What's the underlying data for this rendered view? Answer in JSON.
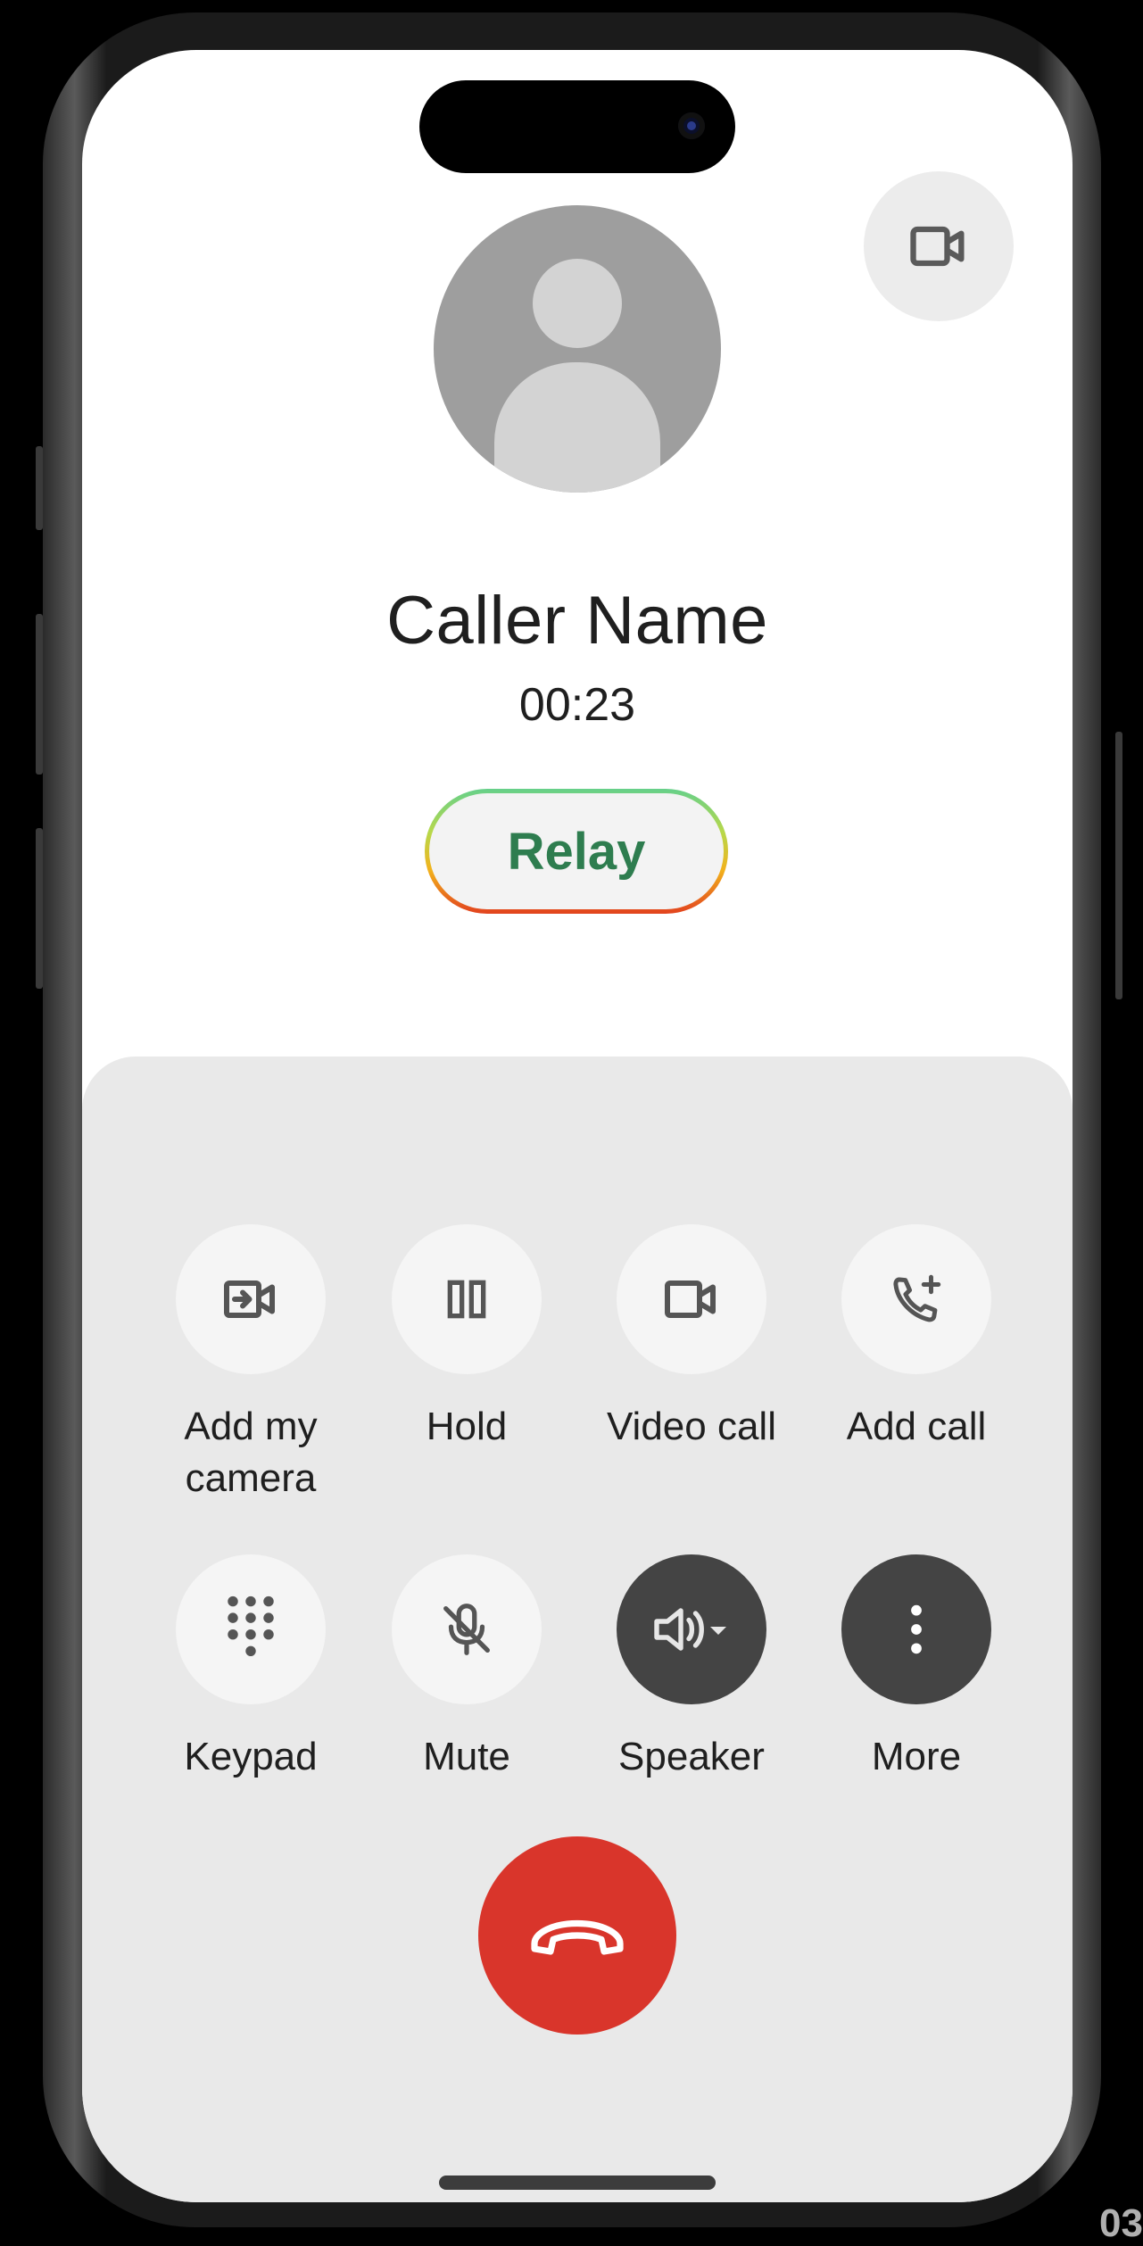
{
  "call": {
    "caller_name": "Caller Name",
    "duration": "00:23",
    "relay_label": "Relay"
  },
  "top_actions": {
    "video_icon": "video-camera-icon"
  },
  "controls": {
    "row1": [
      {
        "label": "Add my\ncamera",
        "icon": "add-camera-icon"
      },
      {
        "label": "Hold",
        "icon": "pause-icon"
      },
      {
        "label": "Video call",
        "icon": "video-camera-icon"
      },
      {
        "label": "Add call",
        "icon": "add-call-icon"
      }
    ],
    "row2": [
      {
        "label": "Keypad",
        "icon": "dialpad-icon"
      },
      {
        "label": "Mute",
        "icon": "mic-off-icon"
      },
      {
        "label": "Speaker",
        "icon": "speaker-icon",
        "active": true
      },
      {
        "label": "More",
        "icon": "more-vert-icon",
        "active": true
      }
    ]
  },
  "end_call": {
    "icon": "call-end-icon",
    "color": "#d9352b"
  },
  "colors": {
    "relay_text": "#2e7d4f",
    "panel_bg": "#e9e9e9",
    "active_button": "#444444"
  },
  "corner_text": "03"
}
